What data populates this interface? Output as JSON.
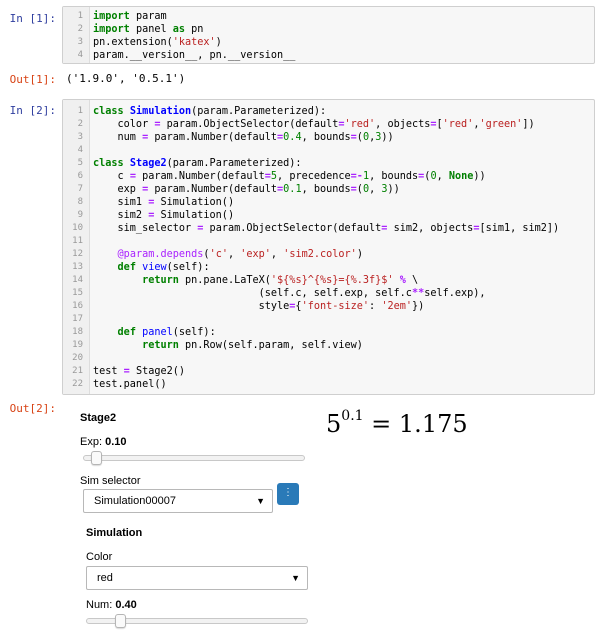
{
  "cells": [
    {
      "prompt": "In [1]:",
      "lines": [
        [
          [
            "kw",
            "import"
          ],
          [
            "t",
            " param"
          ]
        ],
        [
          [
            "kw",
            "import"
          ],
          [
            "t",
            " panel "
          ],
          [
            "kw",
            "as"
          ],
          [
            "t",
            " pn"
          ]
        ],
        [
          [
            "t",
            "pn.extension("
          ],
          [
            "str",
            "'katex'"
          ],
          [
            "t",
            ")"
          ]
        ],
        [
          [
            "t",
            "param.__version__, pn.__version__"
          ]
        ]
      ]
    },
    {
      "prompt": "In [2]:",
      "lines": [
        [
          [
            "kw",
            "class"
          ],
          [
            "t",
            " "
          ],
          [
            "cls",
            "Simulation"
          ],
          [
            "t",
            "(param.Parameterized):"
          ]
        ],
        [
          [
            "t",
            "    color "
          ],
          [
            "op",
            "="
          ],
          [
            "t",
            " param.ObjectSelector(default"
          ],
          [
            "op",
            "="
          ],
          [
            "str",
            "'red'"
          ],
          [
            "t",
            ", objects"
          ],
          [
            "op",
            "="
          ],
          [
            "t",
            "["
          ],
          [
            "str",
            "'red'"
          ],
          [
            "t",
            ","
          ],
          [
            "str",
            "'green'"
          ],
          [
            "t",
            "])"
          ]
        ],
        [
          [
            "t",
            "    num "
          ],
          [
            "op",
            "="
          ],
          [
            "t",
            " param.Number(default"
          ],
          [
            "op",
            "="
          ],
          [
            "num",
            "0.4"
          ],
          [
            "t",
            ", bounds"
          ],
          [
            "op",
            "="
          ],
          [
            "t",
            "("
          ],
          [
            "num",
            "0"
          ],
          [
            "t",
            ","
          ],
          [
            "num",
            "3"
          ],
          [
            "t",
            "))"
          ]
        ],
        [
          [
            "t",
            ""
          ]
        ],
        [
          [
            "kw",
            "class"
          ],
          [
            "t",
            " "
          ],
          [
            "cls",
            "Stage2"
          ],
          [
            "t",
            "(param.Parameterized):"
          ]
        ],
        [
          [
            "t",
            "    c "
          ],
          [
            "op",
            "="
          ],
          [
            "t",
            " param.Number(default"
          ],
          [
            "op",
            "="
          ],
          [
            "num",
            "5"
          ],
          [
            "t",
            ", precedence"
          ],
          [
            "op",
            "=-"
          ],
          [
            "num",
            "1"
          ],
          [
            "t",
            ", bounds"
          ],
          [
            "op",
            "="
          ],
          [
            "t",
            "("
          ],
          [
            "num",
            "0"
          ],
          [
            "t",
            ", "
          ],
          [
            "kw",
            "None"
          ],
          [
            "t",
            "))"
          ]
        ],
        [
          [
            "t",
            "    exp "
          ],
          [
            "op",
            "="
          ],
          [
            "t",
            " param.Number(default"
          ],
          [
            "op",
            "="
          ],
          [
            "num",
            "0.1"
          ],
          [
            "t",
            ", bounds"
          ],
          [
            "op",
            "="
          ],
          [
            "t",
            "("
          ],
          [
            "num",
            "0"
          ],
          [
            "t",
            ", "
          ],
          [
            "num",
            "3"
          ],
          [
            "t",
            "))"
          ]
        ],
        [
          [
            "t",
            "    sim1 "
          ],
          [
            "op",
            "="
          ],
          [
            "t",
            " Simulation()"
          ]
        ],
        [
          [
            "t",
            "    sim2 "
          ],
          [
            "op",
            "="
          ],
          [
            "t",
            " Simulation()"
          ]
        ],
        [
          [
            "t",
            "    sim_selector "
          ],
          [
            "op",
            "="
          ],
          [
            "t",
            " param.ObjectSelector(default"
          ],
          [
            "op",
            "="
          ],
          [
            "t",
            " sim2, objects"
          ],
          [
            "op",
            "="
          ],
          [
            "t",
            "[sim1, sim2])"
          ]
        ],
        [
          [
            "t",
            ""
          ]
        ],
        [
          [
            "t",
            "    "
          ],
          [
            "dec",
            "@param.depends"
          ],
          [
            "t",
            "("
          ],
          [
            "str",
            "'c'"
          ],
          [
            "t",
            ", "
          ],
          [
            "str",
            "'exp'"
          ],
          [
            "t",
            ", "
          ],
          [
            "str",
            "'sim2.color'"
          ],
          [
            "t",
            ")"
          ]
        ],
        [
          [
            "t",
            "    "
          ],
          [
            "kw",
            "def"
          ],
          [
            "t",
            " "
          ],
          [
            "fn",
            "view"
          ],
          [
            "t",
            "(self):"
          ]
        ],
        [
          [
            "t",
            "        "
          ],
          [
            "kw",
            "return"
          ],
          [
            "t",
            " pn.pane.LaTeX("
          ],
          [
            "str",
            "'${%s}^{%s}={%.3f}$'"
          ],
          [
            "t",
            " "
          ],
          [
            "op",
            "%"
          ],
          [
            "t",
            " \\"
          ]
        ],
        [
          [
            "t",
            "                           (self.c, self.exp, self.c"
          ],
          [
            "op",
            "**"
          ],
          [
            "t",
            "self.exp),"
          ]
        ],
        [
          [
            "t",
            "                           style"
          ],
          [
            "op",
            "="
          ],
          [
            "t",
            "{"
          ],
          [
            "str",
            "'font-size'"
          ],
          [
            "t",
            ": "
          ],
          [
            "str",
            "'2em'"
          ],
          [
            "t",
            "})"
          ]
        ],
        [
          [
            "t",
            ""
          ]
        ],
        [
          [
            "t",
            "    "
          ],
          [
            "kw",
            "def"
          ],
          [
            "t",
            " "
          ],
          [
            "fn",
            "panel"
          ],
          [
            "t",
            "(self):"
          ]
        ],
        [
          [
            "t",
            "        "
          ],
          [
            "kw",
            "return"
          ],
          [
            "t",
            " pn.Row(self.param, self.view)"
          ]
        ],
        [
          [
            "t",
            ""
          ]
        ],
        [
          [
            "t",
            "test "
          ],
          [
            "op",
            "="
          ],
          [
            "t",
            " Stage2()"
          ]
        ],
        [
          [
            "t",
            "test.panel()"
          ]
        ]
      ]
    }
  ],
  "out1": {
    "prompt": "Out[1]:",
    "text": "('1.9.0', '0.5.1')"
  },
  "out2": {
    "prompt": "Out[2]:",
    "stage_title": "Stage2",
    "exp_label": "Exp: ",
    "exp_value": "0.10",
    "exp_fraction": 0.0333,
    "sim_selector_label": "Sim selector",
    "sim_selector_value": "Simulation00007",
    "sim_button_icon": "more-icon",
    "sim_button_glyph": "⋮",
    "simulation_title": "Simulation",
    "color_label": "Color",
    "color_value": "red",
    "num_label": "Num: ",
    "num_value": "0.40",
    "num_fraction": 0.1333,
    "latex_base": "5",
    "latex_exp": "0.1",
    "latex_rest": " = 1.175"
  }
}
